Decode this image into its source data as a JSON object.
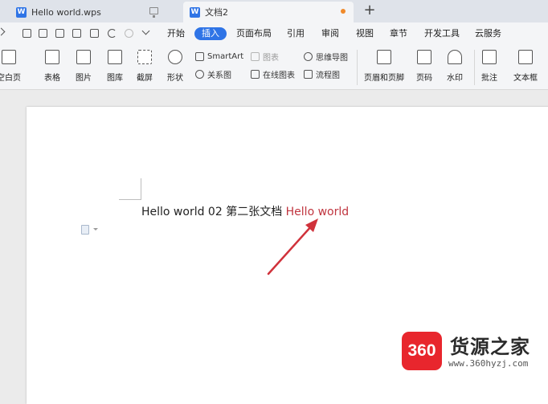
{
  "tabs": [
    {
      "label": "Hello world.wps"
    },
    {
      "label": "文档2"
    }
  ],
  "menu": [
    "开始",
    "插入",
    "页面布局",
    "引用",
    "审阅",
    "视图",
    "章节",
    "开发工具",
    "云服务"
  ],
  "ribbon": {
    "blank_page": "空白页",
    "table": "表格",
    "picture": "图片",
    "gallery": "图库",
    "screenshot": "截屏",
    "shapes": "形状",
    "smartart": "SmartArt",
    "chart": "图表",
    "relation": "关系图",
    "online_chart": "在线图表",
    "mindmap": "思维导图",
    "flowchart": "流程图",
    "header_footer": "页眉和页脚",
    "page_number": "页码",
    "watermark": "水印",
    "comment": "批注",
    "textbox": "文本框"
  },
  "document": {
    "text_black": "Hello world 02 第二张文档 ",
    "text_red": "Hello world"
  },
  "watermark": {
    "logo": "360",
    "title": "货源之家",
    "url": "www.360hyzj.com"
  },
  "colors": {
    "accent": "#2f74e6",
    "highlight_red": "#c0353f",
    "logo_red": "#e8262d"
  }
}
